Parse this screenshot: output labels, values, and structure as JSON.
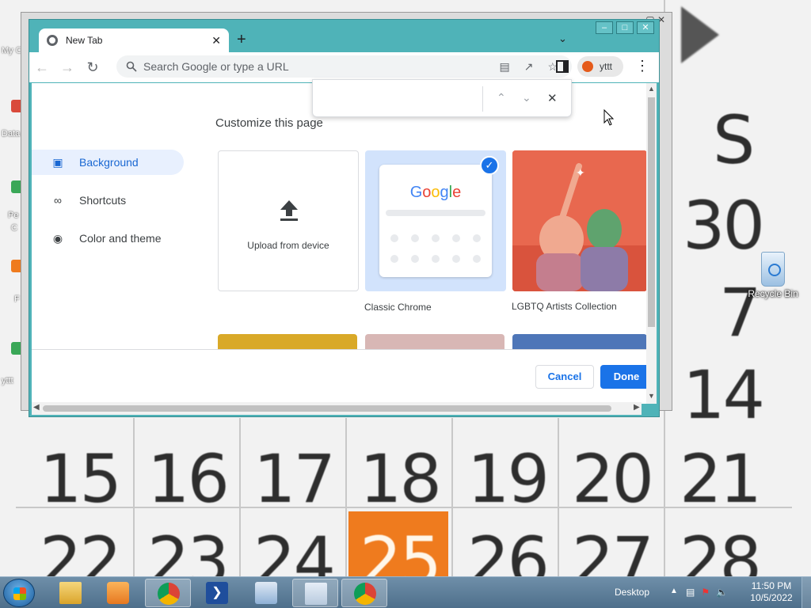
{
  "desktop": {
    "calendar_days": [
      "S",
      "30",
      "7",
      "14",
      "15",
      "16",
      "17",
      "18",
      "19",
      "20",
      "21",
      "22",
      "23",
      "24",
      "25",
      "26",
      "27",
      "28"
    ],
    "today": "25",
    "side_labels": [
      "My C",
      "Data",
      "Pe",
      "C",
      "F",
      "yttt"
    ],
    "recycle_bin_label": "Recycle Bin"
  },
  "browser": {
    "tab_title": "New Tab",
    "omnibox_placeholder": "Search Google or type a URL",
    "profile_name": "yttt"
  },
  "dialog": {
    "title": "Customize this page",
    "nav": [
      {
        "label": "Background",
        "icon": "image-icon",
        "active": true
      },
      {
        "label": "Shortcuts",
        "icon": "link-icon",
        "active": false
      },
      {
        "label": "Color and theme",
        "icon": "palette-icon",
        "active": false
      }
    ],
    "tiles": {
      "upload_label": "Upload from device",
      "classic_label": "Classic Chrome",
      "classic_logo": "Google",
      "lgbtq_label": "LGBTQ Artists Collection"
    },
    "cancel_label": "Cancel",
    "done_label": "Done"
  },
  "taskbar": {
    "desktop_label": "Desktop",
    "time": "11:50 PM",
    "date": "10/5/2022"
  },
  "colors": {
    "chrome_frame": "#4fb3b8",
    "accent_blue": "#1a73e8",
    "today_orange": "#ef7b1e"
  }
}
